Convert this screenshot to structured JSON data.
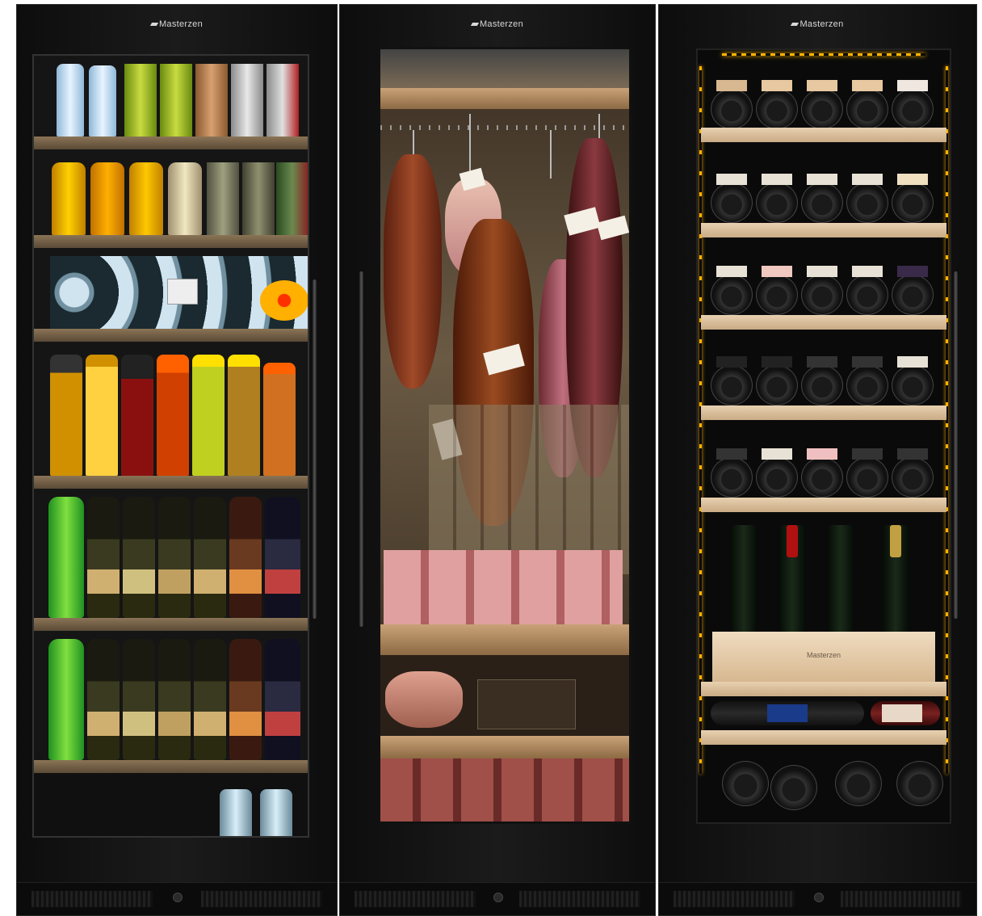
{
  "cabinets": [
    {
      "brand": "Masterzen",
      "type": "beverage"
    },
    {
      "brand": "Masterzen",
      "type": "meat-aging"
    },
    {
      "brand": "Masterzen",
      "type": "wine"
    }
  ],
  "crate_brand": "Masterzen",
  "colors": {
    "cabinet": "#111111",
    "led": "#ffb300",
    "wood_shelf": "#c9a277",
    "beech_shelf": "#e8d0b0"
  }
}
